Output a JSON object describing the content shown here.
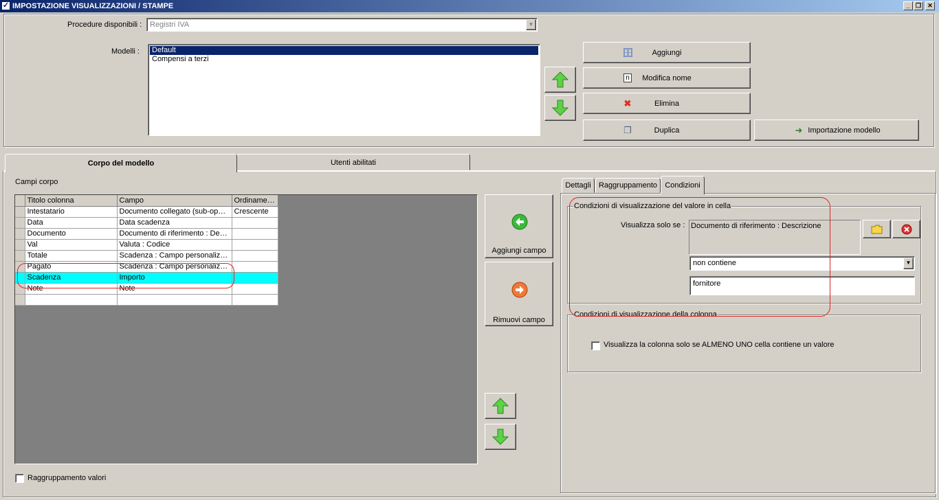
{
  "window": {
    "title": "IMPOSTAZIONE VISUALIZZAZIONI / STAMPE",
    "min_label": "_",
    "max_label": "❐",
    "close_label": "✕"
  },
  "header": {
    "procedure_label": "Procedure disponibili :",
    "procedure_value": "Registri IVA",
    "models_label": "Modelli :",
    "models": [
      {
        "label": "Default",
        "selected": true
      },
      {
        "label": "Compensi a terzi",
        "selected": false
      }
    ],
    "buttons": {
      "add": "Aggiungi",
      "rename": "Modifica nome",
      "delete": "Elimina",
      "duplicate": "Duplica",
      "import": "Importazione modello"
    }
  },
  "tabs": {
    "body": "Corpo del modello",
    "users": "Utenti abilitati"
  },
  "body": {
    "fields_label": "Campi corpo",
    "columns": [
      "Titolo colonna",
      "Campo",
      "Ordinamento"
    ],
    "rows": [
      [
        "Intestatario",
        "Documento collegato (sub-opzio...",
        "Crescente"
      ],
      [
        "Data",
        "Data scadenza",
        ""
      ],
      [
        "Documento",
        "Documento di riferimento : Desc...",
        ""
      ],
      [
        "Val",
        "Valuta : Codice",
        ""
      ],
      [
        "Totale",
        "Scadenza : Campo personalizza...",
        ""
      ],
      [
        "Pagato",
        "Scadenza : Campo personalizza...",
        ""
      ],
      [
        "Scadenza",
        "Importo",
        ""
      ],
      [
        "Note",
        "Note",
        ""
      ],
      [
        "",
        "",
        ""
      ]
    ],
    "highlight_row": 6,
    "add_field": "Aggiungi campo",
    "remove_field": "Rimuovi campo",
    "grouping_label": "Raggruppamento valori"
  },
  "right": {
    "tabs": [
      "Dettagli",
      "Raggruppamento",
      "Condizioni"
    ],
    "active_tab": 2,
    "cell_group_title": "Condizioni di visualizzazione del valore in cella",
    "show_only_if_label": "Visualizza solo se :",
    "field_value": "Documento di riferimento : Descrizione",
    "operator_value": "non contiene",
    "text_value": "fornitore",
    "column_group_title": "Condizioni di visualizzazione della colonna",
    "column_check_label": "Visualizza la colonna solo se ALMENO UNO cella contiene un valore"
  },
  "colors": {
    "titlebar_start": "#0a246a",
    "titlebar_end": "#a6caf0",
    "selection": "#0a246a",
    "highlight_row": "#00ffff",
    "annotation": "#e02020",
    "gray_area": "#808080"
  },
  "icons": {
    "add": "add-db-icon",
    "rename": "rename-n-icon",
    "delete": "red-x-icon",
    "duplicate": "copy-icon",
    "import": "import-icon",
    "add_field": "green-left-arrow-icon",
    "remove_field": "orange-right-arrow-icon",
    "folder": "folder-icon",
    "clear": "red-cancel-icon"
  }
}
